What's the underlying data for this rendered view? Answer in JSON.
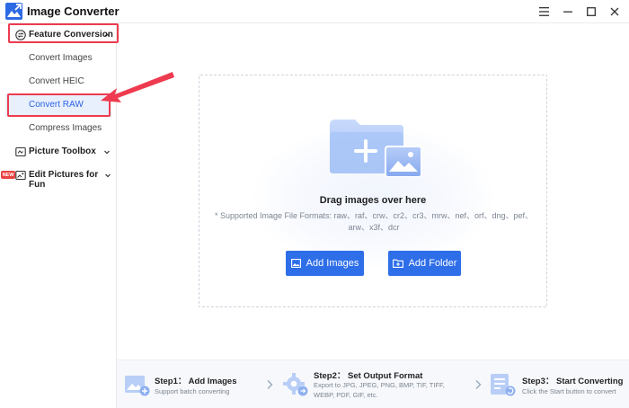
{
  "window": {
    "title": "Image Converter",
    "menu_icon": "hamburger-menu-icon",
    "minimize_icon": "minimize-icon",
    "maximize_icon": "maximize-icon",
    "close_icon": "close-icon"
  },
  "sidebar": {
    "feature_conversion": {
      "label": "Feature Conversion",
      "icon": "convert-icon",
      "expanded": true
    },
    "items": [
      {
        "label": "Convert Images"
      },
      {
        "label": "Convert HEIC"
      },
      {
        "label": "Convert RAW",
        "active": true
      },
      {
        "label": "Compress Images"
      }
    ],
    "picture_toolbox": {
      "label": "Picture Toolbox",
      "icon": "toolbox-icon"
    },
    "edit_pictures": {
      "label": "Edit Pictures for Fun",
      "icon": "edit-picture-icon",
      "badge": "NEW"
    }
  },
  "dropzone": {
    "title": "Drag images over here",
    "formats_line1": "* Supported Image File Formats: raw、raf、crw、cr2、cr3、mrw、nef、orf、dng、pef、",
    "formats_line2": "arw、x3f、dcr",
    "add_images_label": "Add Images",
    "add_folder_label": "Add Folder"
  },
  "steps": [
    {
      "title": "Step1： Add Images",
      "desc": [
        "Support batch converting"
      ]
    },
    {
      "title": "Step2： Set Output Format",
      "desc": [
        "Export to JPG, JPEG, PNG, BMP, TIF, TIFF,",
        "WEBP, PDF, GIF, etc."
      ]
    },
    {
      "title": "Step3： Start Converting",
      "desc": [
        "Click the Start button to convert"
      ]
    }
  ],
  "colors": {
    "accent": "#2e6ee8",
    "highlight": "#ee3b4f",
    "active_bg": "#e9f0fd"
  }
}
